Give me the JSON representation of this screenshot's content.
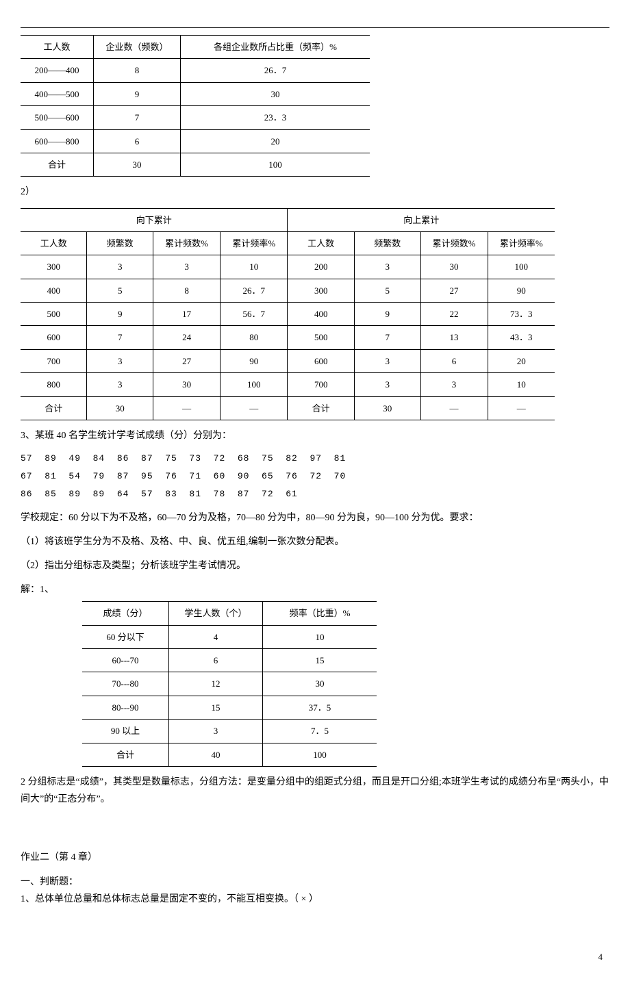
{
  "table1": {
    "headers": [
      "工人数",
      "企业数（频数）",
      "各组企业数所占比重（频率）%"
    ],
    "rows": [
      [
        "200——400",
        "8",
        "26．7"
      ],
      [
        "400——500",
        "9",
        "30"
      ],
      [
        "500——600",
        "7",
        "23．3"
      ],
      [
        "600——800",
        "6",
        "20"
      ],
      [
        "合计",
        "30",
        "100"
      ]
    ]
  },
  "label_2": "2）",
  "table2": {
    "group_headers": [
      "向下累计",
      "向上累计"
    ],
    "sub_headers": [
      "工人数",
      "频繁数",
      "累计频数%",
      "累计频率%",
      "工人数",
      "频繁数",
      "累计频数%",
      "累计频率%"
    ],
    "rows": [
      [
        "300",
        "3",
        "3",
        "10",
        "200",
        "3",
        "30",
        "100"
      ],
      [
        "400",
        "5",
        "8",
        "26．7",
        "300",
        "5",
        "27",
        "90"
      ],
      [
        "500",
        "9",
        "17",
        "56．7",
        "400",
        "9",
        "22",
        "73．3"
      ],
      [
        "600",
        "7",
        "24",
        "80",
        "500",
        "7",
        "13",
        "43．3"
      ],
      [
        "700",
        "3",
        "27",
        "90",
        "600",
        "3",
        "6",
        "20"
      ],
      [
        "800",
        "3",
        "30",
        "100",
        "700",
        "3",
        "3",
        "10"
      ],
      [
        "合计",
        "30",
        "—",
        "—",
        "合计",
        "30",
        "—",
        "—"
      ]
    ]
  },
  "q3_title": "3、某班 40 名学生统计学考试成绩（分）分别为：",
  "data_rows": [
    "57  89  49  84  86  87  75  73  72  68  75  82  97  81",
    "67  81  54  79  87  95  76  71  60  90  65  76  72  70",
    "86  85  89  89  64  57  83  81  78  87  72  61"
  ],
  "rule_text": "学校规定：60 分以下为不及格，60—70 分为及格，70—80 分为中，80—90 分为良，90—100 分为优。要求：",
  "req1": "（1）将该班学生分为不及格、及格、中、良、优五组,编制一张次数分配表。",
  "req2": "（2）指出分组标志及类型；分析该班学生考试情况。",
  "solve_label": "解：1、",
  "table3": {
    "headers": [
      "成绩（分）",
      "学生人数（个）",
      "频率（比重）%"
    ],
    "rows": [
      [
        "60 分以下",
        "4",
        "10"
      ],
      [
        "60---70",
        "6",
        "15"
      ],
      [
        "70---80",
        "12",
        "30"
      ],
      [
        "80---90",
        "15",
        "37．5"
      ],
      [
        "90 以上",
        "3",
        "7．5"
      ],
      [
        "合计",
        "40",
        "100"
      ]
    ]
  },
  "analysis": "2 分组标志是“成绩”，其类型是数量标志，分组方法：是变量分组中的组距式分组，而且是开口分组;本班学生考试的成绩分布呈“两头小，中间大”的“正态分布”。",
  "hw2_title": "作业二（第 4 章）",
  "section1": "一、判断题：",
  "judge1": "1、总体单位总量和总体标志总量是固定不变的，不能互相变换。（ × ）",
  "page_number": "4"
}
